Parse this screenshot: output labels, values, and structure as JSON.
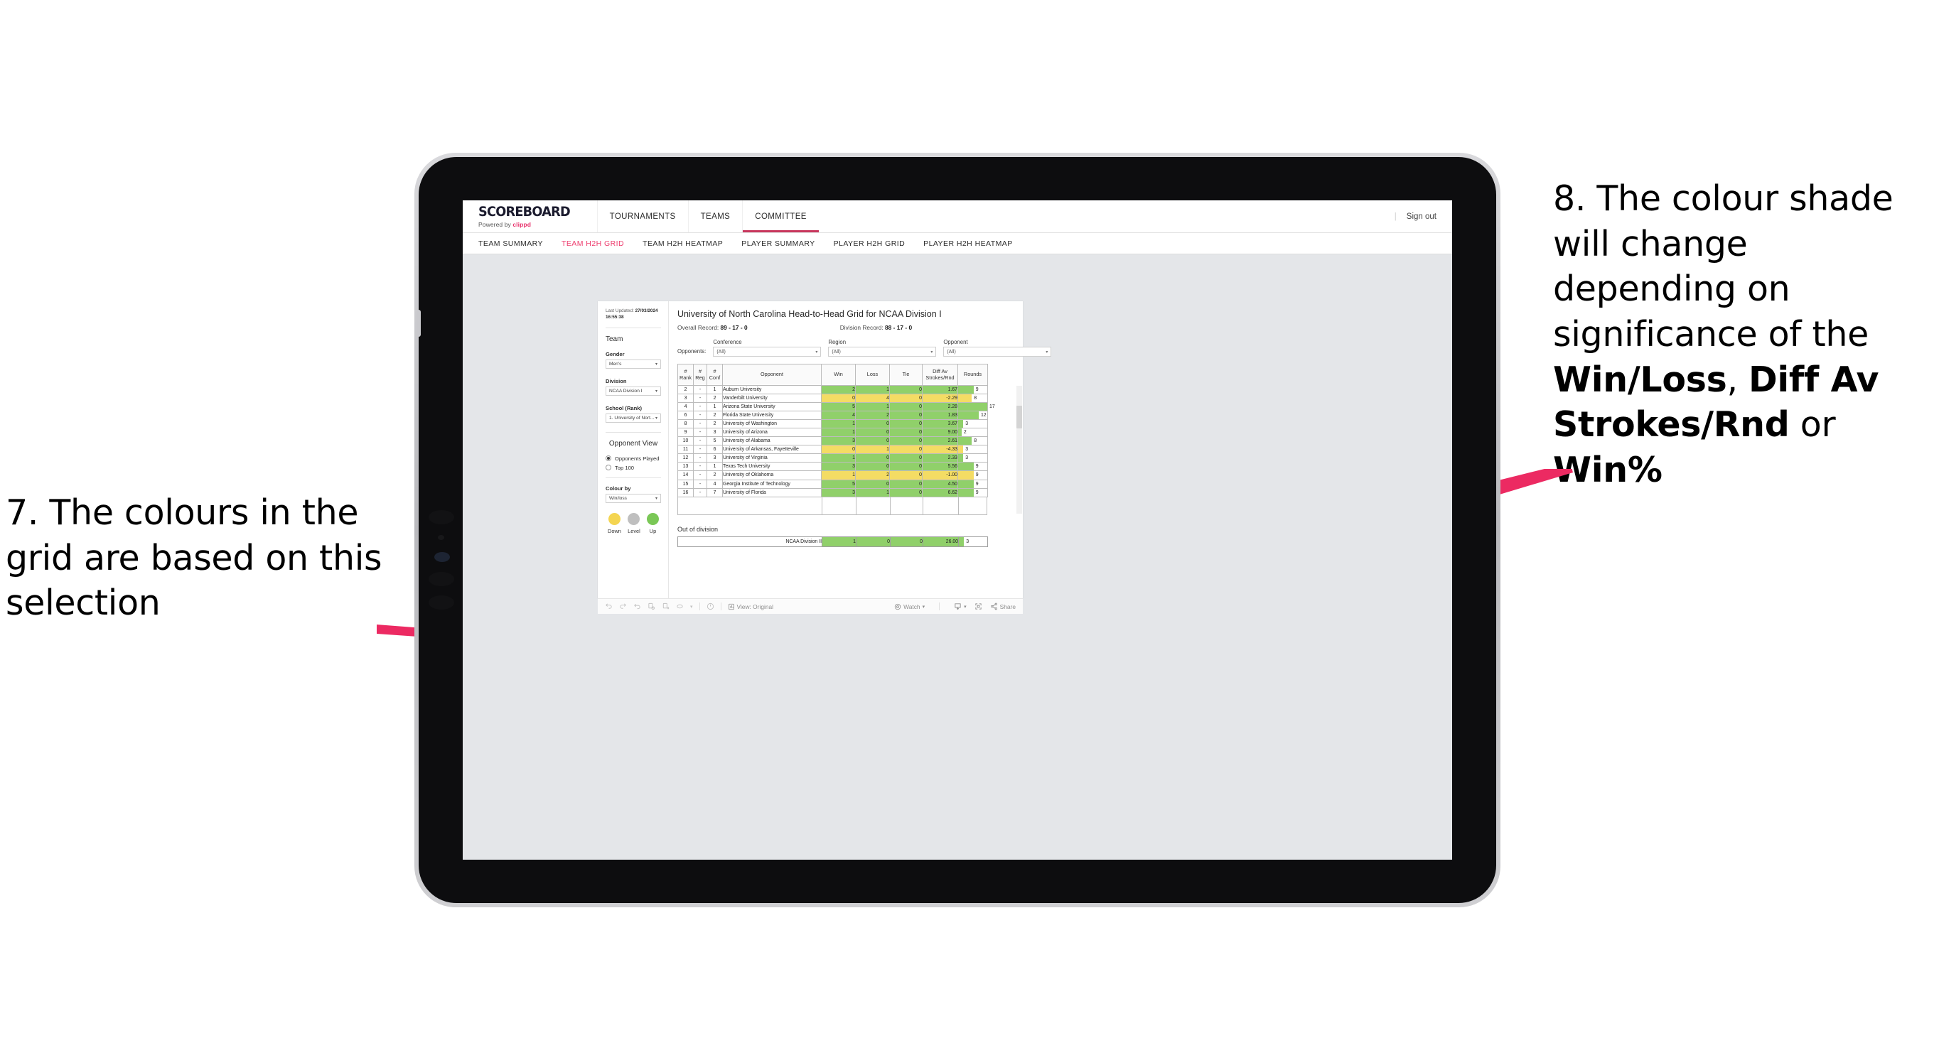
{
  "annotations": {
    "left": {
      "text": "7. The colours in the grid are based on this selection"
    },
    "right": {
      "line1": "8. The colour shade will change depending on significance of the ",
      "bold1": "Win/Loss",
      "mid1": ", ",
      "bold2": "Diff Av Strokes/Rnd",
      "mid2": " or ",
      "bold3": "Win%"
    }
  },
  "app": {
    "brand": {
      "name": "SCOREBOARD",
      "powered_prefix": "Powered by ",
      "powered_brand": "clippd"
    },
    "topnav": [
      {
        "label": "TOURNAMENTS",
        "active": false
      },
      {
        "label": "TEAMS",
        "active": false
      },
      {
        "label": "COMMITTEE",
        "active": true
      }
    ],
    "header_right": {
      "divider": "|",
      "signout": "Sign out"
    },
    "subnav": [
      {
        "label": "TEAM SUMMARY",
        "active": false
      },
      {
        "label": "TEAM H2H GRID",
        "active": true
      },
      {
        "label": "TEAM H2H HEATMAP",
        "active": false
      },
      {
        "label": "PLAYER SUMMARY",
        "active": false
      },
      {
        "label": "PLAYER H2H GRID",
        "active": false
      },
      {
        "label": "PLAYER H2H HEATMAP",
        "active": false
      }
    ]
  },
  "panel": {
    "last_updated_label": "Last Updated: ",
    "last_updated_date": "27/03/2024",
    "last_updated_time": "16:55:38",
    "team_heading": "Team",
    "gender_label": "Gender",
    "gender_value": "Men's",
    "division_label": "Division",
    "division_value": "NCAA Division I",
    "school_label": "School (Rank)",
    "school_value": "1. University of Nort...",
    "opponent_view_heading": "Opponent View",
    "opponent_view_options": [
      {
        "label": "Opponents Played",
        "selected": true
      },
      {
        "label": "Top 100",
        "selected": false
      }
    ],
    "colour_by_label": "Colour by",
    "colour_by_value": "Win/loss",
    "legend": [
      {
        "label": "Down",
        "color": "#f4d551"
      },
      {
        "label": "Level",
        "color": "#bfbfbf"
      },
      {
        "label": "Up",
        "color": "#7ac756"
      }
    ]
  },
  "viz": {
    "title": "University of North Carolina Head-to-Head Grid for NCAA Division I",
    "overall_record_label": "Overall Record: ",
    "overall_record_value": "89 - 17 - 0",
    "division_record_label": "Division Record: ",
    "division_record_value": "88 - 17 - 0",
    "opponents_label": "Opponents:",
    "filters": [
      {
        "label": "Conference",
        "value": "(All)"
      },
      {
        "label": "Region",
        "value": "(All)"
      },
      {
        "label": "Opponent",
        "value": "(All)"
      }
    ],
    "out_of_division_heading": "Out of division"
  },
  "chart_data": {
    "type": "table",
    "title": "University of North Carolina Head-to-Head Grid for NCAA Division I",
    "columns": [
      "# Rank",
      "# Reg",
      "# Conf",
      "Opponent",
      "Win",
      "Loss",
      "Tie",
      "Diff Av Strokes/Rnd",
      "Rounds"
    ],
    "column_header_lines": [
      [
        "#",
        "Rank"
      ],
      [
        "#",
        "Reg"
      ],
      [
        "#",
        "Conf"
      ],
      [
        "Opponent"
      ],
      [
        "Win"
      ],
      [
        "Loss"
      ],
      [
        "Tie"
      ],
      [
        "Diff Av",
        "Strokes/Rnd"
      ],
      [
        "Rounds"
      ]
    ],
    "rounds_max": 17,
    "colors": {
      "up": "#90d06a",
      "down": "#f4dc64",
      "level": "#bfbfbf"
    },
    "rows": [
      {
        "rank": "2",
        "reg": "-",
        "conf": "1",
        "opponent": "Auburn University",
        "win": "2",
        "loss": "1",
        "tie": "0",
        "diff": "1.67",
        "rounds": "9",
        "state": "up"
      },
      {
        "rank": "3",
        "reg": "-",
        "conf": "2",
        "opponent": "Vanderbilt University",
        "win": "0",
        "loss": "4",
        "tie": "0",
        "diff": "-2.29",
        "rounds": "8",
        "state": "down"
      },
      {
        "rank": "4",
        "reg": "-",
        "conf": "1",
        "opponent": "Arizona State University",
        "win": "5",
        "loss": "1",
        "tie": "0",
        "diff": "2.28",
        "rounds": "17",
        "state": "up"
      },
      {
        "rank": "6",
        "reg": "-",
        "conf": "2",
        "opponent": "Florida State University",
        "win": "4",
        "loss": "2",
        "tie": "0",
        "diff": "1.83",
        "rounds": "12",
        "state": "up"
      },
      {
        "rank": "8",
        "reg": "-",
        "conf": "2",
        "opponent": "University of Washington",
        "win": "1",
        "loss": "0",
        "tie": "0",
        "diff": "3.67",
        "rounds": "3",
        "state": "up"
      },
      {
        "rank": "9",
        "reg": "-",
        "conf": "3",
        "opponent": "University of Arizona",
        "win": "1",
        "loss": "0",
        "tie": "0",
        "diff": "9.00",
        "rounds": "2",
        "state": "up"
      },
      {
        "rank": "10",
        "reg": "-",
        "conf": "5",
        "opponent": "University of Alabama",
        "win": "3",
        "loss": "0",
        "tie": "0",
        "diff": "2.61",
        "rounds": "8",
        "state": "up"
      },
      {
        "rank": "11",
        "reg": "-",
        "conf": "6",
        "opponent": "University of Arkansas, Fayetteville",
        "win": "0",
        "loss": "1",
        "tie": "0",
        "diff": "-4.33",
        "rounds": "3",
        "state": "down"
      },
      {
        "rank": "12",
        "reg": "-",
        "conf": "3",
        "opponent": "University of Virginia",
        "win": "1",
        "loss": "0",
        "tie": "0",
        "diff": "2.33",
        "rounds": "3",
        "state": "up"
      },
      {
        "rank": "13",
        "reg": "-",
        "conf": "1",
        "opponent": "Texas Tech University",
        "win": "3",
        "loss": "0",
        "tie": "0",
        "diff": "5.56",
        "rounds": "9",
        "state": "up"
      },
      {
        "rank": "14",
        "reg": "-",
        "conf": "2",
        "opponent": "University of Oklahoma",
        "win": "1",
        "loss": "2",
        "tie": "0",
        "diff": "-1.00",
        "rounds": "9",
        "state": "down"
      },
      {
        "rank": "15",
        "reg": "-",
        "conf": "4",
        "opponent": "Georgia Institute of Technology",
        "win": "5",
        "loss": "0",
        "tie": "0",
        "diff": "4.50",
        "rounds": "9",
        "state": "up"
      },
      {
        "rank": "16",
        "reg": "-",
        "conf": "7",
        "opponent": "University of Florida",
        "win": "3",
        "loss": "1",
        "tie": "0",
        "diff": "6.62",
        "rounds": "9",
        "state": "up"
      }
    ],
    "out_of_division": [
      {
        "label": "NCAA Division II",
        "win": "1",
        "loss": "0",
        "tie": "0",
        "diff": "26.00",
        "rounds": "3",
        "state": "up"
      }
    ]
  },
  "toolbar": {
    "view_label": "View: Original",
    "watch_label": "Watch",
    "share_label": "Share"
  }
}
